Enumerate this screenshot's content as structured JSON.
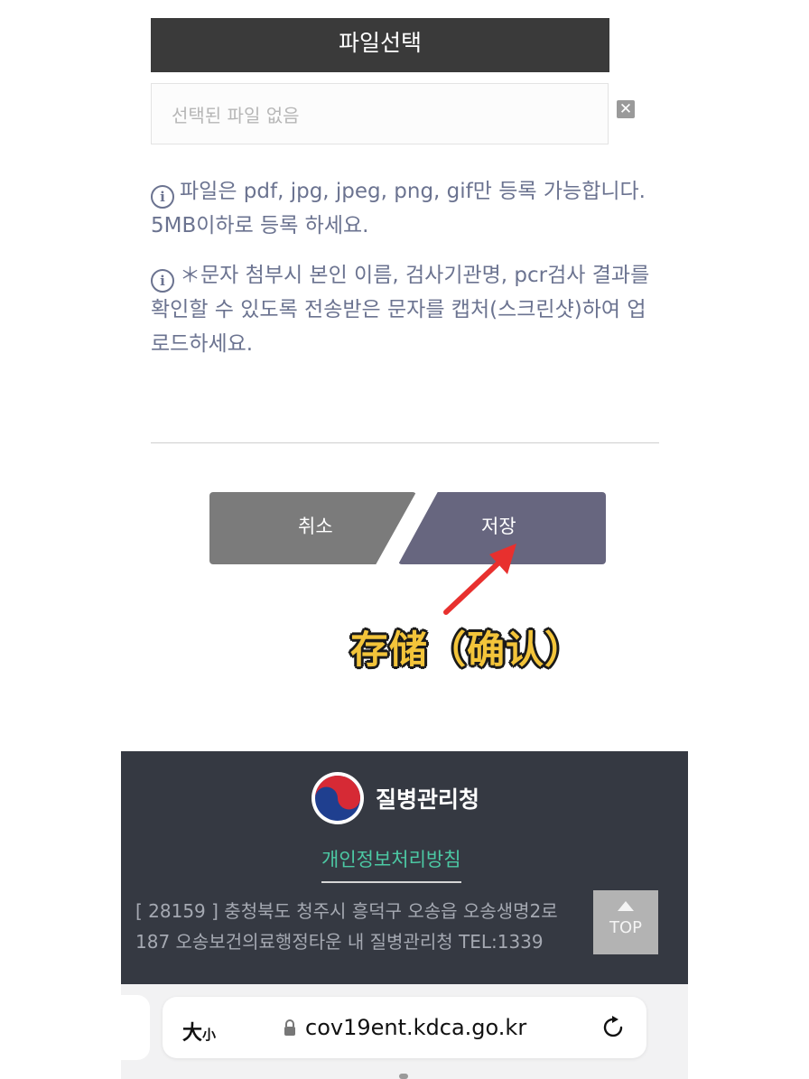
{
  "upload": {
    "select_label": "파일선택",
    "file_placeholder": "선택된 파일 없음",
    "clear_symbol": "✕"
  },
  "notices": [
    "파일은 pdf, jpg, jpeg, png, gif만 등록 가능합니다. 5MB이하로 등록 하세요.",
    "＊문자 첨부시 본인 이름, 검사기관명, pcr검사 결과를 확인할 수 있도록 전송받은 문자를 캡처(스크린샷)하여 업로드하세요."
  ],
  "actions": {
    "cancel_label": "취소",
    "save_label": "저장"
  },
  "annotation": {
    "text": "存储（确认）",
    "color": "#f3c43a",
    "arrow_color": "#e8302e"
  },
  "footer": {
    "agency_name": "질병관리청",
    "privacy_link": "개인정보처리방침",
    "address": "[ 28159 ] 충청북도 청주시 흥덕구 오송읍 오송생명2로 187 오송보건의료행정타운 내 질병관리청 TEL:1339",
    "top_label": "TOP"
  },
  "browser": {
    "text_size_big": "大",
    "text_size_small": "小",
    "url": "cov19ent.kdca.go.kr"
  },
  "colors": {
    "dark_button": "#3a3a3a",
    "cancel_button": "#7b7b7b",
    "save_button": "#67667f",
    "notice_text": "#6b7390",
    "footer_bg": "#353942",
    "privacy_link": "#4cc9a4"
  }
}
